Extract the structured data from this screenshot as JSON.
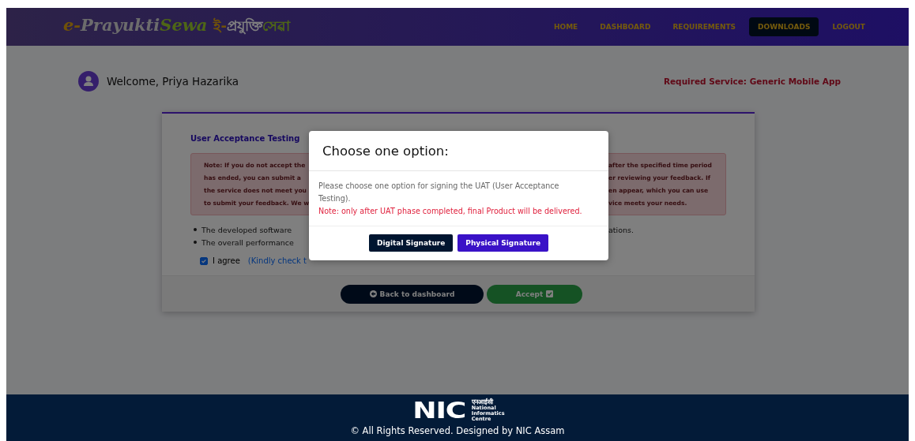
{
  "header": {
    "logo": {
      "latin_prefix": "e-",
      "latin_main": "Prayukti",
      "latin_suffix": "Sewa",
      "native_prefix": "ই-",
      "native_main": "প্রযুক্তি",
      "native_suffix": "সেৱা"
    },
    "nav": [
      {
        "label": "HOME",
        "selected": false
      },
      {
        "label": "DASHBOARD",
        "selected": false
      },
      {
        "label": "REQUIREMENTS",
        "selected": false
      },
      {
        "label": "DOWNLOADS",
        "selected": true
      },
      {
        "label": "LOGOUT",
        "selected": false
      }
    ]
  },
  "welcome": {
    "greeting": "Welcome, Priya Hazarika",
    "required_service": "Required Service: Generic Mobile App"
  },
  "card": {
    "title": "User Acceptance Testing",
    "note_left": [
      "Note: If you do not accept the",
      "has ended, you can submit a",
      "the service does not meet you",
      "to submit your feedback. We w"
    ],
    "note_right": [
      "after the specified time period",
      "er reviewing your feedback. If",
      "en appear, which you can use",
      "vice meets your needs."
    ],
    "bullets": [
      {
        "left": "The developed software",
        "right": "ations."
      },
      {
        "left": "The overall performance"
      }
    ],
    "agree": {
      "label": "I agree",
      "link": "(Kindly check t",
      "checked": true
    },
    "buttons": [
      {
        "label": "Back to dashboard",
        "kind": "back"
      },
      {
        "label": "Accept",
        "kind": "accept"
      }
    ]
  },
  "modal": {
    "title": "Choose one option:",
    "message": "Please choose one option for signing the UAT (User Acceptance Testing).",
    "note": "Note: only after UAT phase completed, final Product will be delivered.",
    "buttons": [
      {
        "label": "Digital Signature",
        "kind": "dark"
      },
      {
        "label": "Physical Signature",
        "kind": "primary"
      }
    ]
  },
  "footer": {
    "logo_mark": "NIC",
    "logo_hindi": "एनआईसी",
    "logo_lines": [
      "National",
      "Informatics",
      "Centre"
    ],
    "copyright": "© All Rights Reserved. Designed by NIC Assam"
  }
}
